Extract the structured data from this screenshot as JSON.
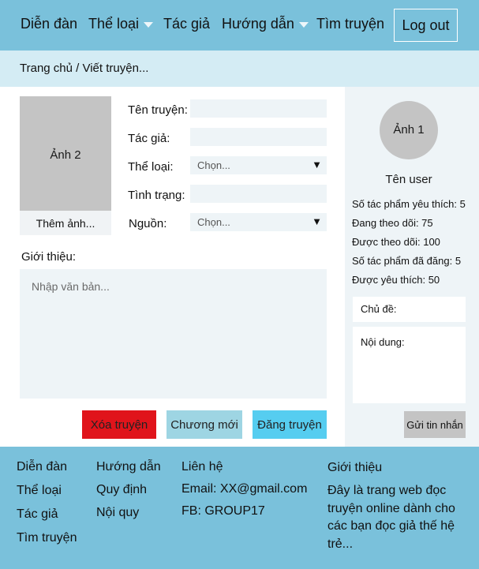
{
  "navbar": {
    "items": [
      {
        "label": "Diễn đàn",
        "dropdown": false
      },
      {
        "label": "Thể loại",
        "dropdown": true
      },
      {
        "label": "Tác giả",
        "dropdown": false
      },
      {
        "label": "Hướng dẫn",
        "dropdown": true
      },
      {
        "label": "Tìm truyện",
        "dropdown": false
      }
    ],
    "logout_label": "Log out"
  },
  "breadcrumb": "Trang chủ / Viết truyện...",
  "form": {
    "cover_label": "Ảnh 2",
    "add_image_label": "Thêm ảnh...",
    "fields": {
      "title": {
        "label": "Tên truyện:",
        "value": ""
      },
      "author": {
        "label": "Tác giả:",
        "value": ""
      },
      "genre": {
        "label": "Thể loại:",
        "selected": "Chọn..."
      },
      "status": {
        "label": "Tình trạng:",
        "value": ""
      },
      "source": {
        "label": "Nguồn:",
        "selected": "Chọn..."
      }
    },
    "intro_label": "Giới thiệu:",
    "intro_placeholder": "Nhập văn bản...",
    "buttons": {
      "delete": "Xóa truyện",
      "new_chapter": "Chương mới",
      "post": "Đăng truyện"
    }
  },
  "sidebar": {
    "avatar_label": "Ảnh 1",
    "username": "Tên user",
    "stats": [
      "Số tác phẩm yêu thích: 5",
      "Đang theo dõi: 75",
      "Được theo dõi: 100",
      "Số tác phẩm đã đăng: 5",
      "Được yêu thích: 50"
    ],
    "subject_label": "Chủ đề:",
    "content_label": "Nội dung:",
    "send_label": "Gửi tin nhắn"
  },
  "footer": {
    "col1": [
      "Diễn đàn",
      "Thể loại",
      "Tác giả",
      "Tìm truyện"
    ],
    "col2": [
      "Hướng dẫn",
      "Quy định",
      "Nội quy"
    ],
    "contact": {
      "heading": "Liên hệ",
      "email": "Email: XX@gmail.com",
      "fb": "FB: GROUP17"
    },
    "about": {
      "heading": "Giới thiệu",
      "text": "Đây là trang web đọc truyện online dành cho các bạn đọc giả thế hệ trẻ..."
    }
  },
  "colors": {
    "navbar_bg": "#7ac1db",
    "breadcrumb_bg": "#d4ecf4",
    "input_bg": "#eef4f7",
    "delete_button": "#e0141b",
    "new_chapter_button": "#9ed5e3",
    "post_button": "#56cdf0",
    "placeholder_gray": "#c4c4c4"
  }
}
